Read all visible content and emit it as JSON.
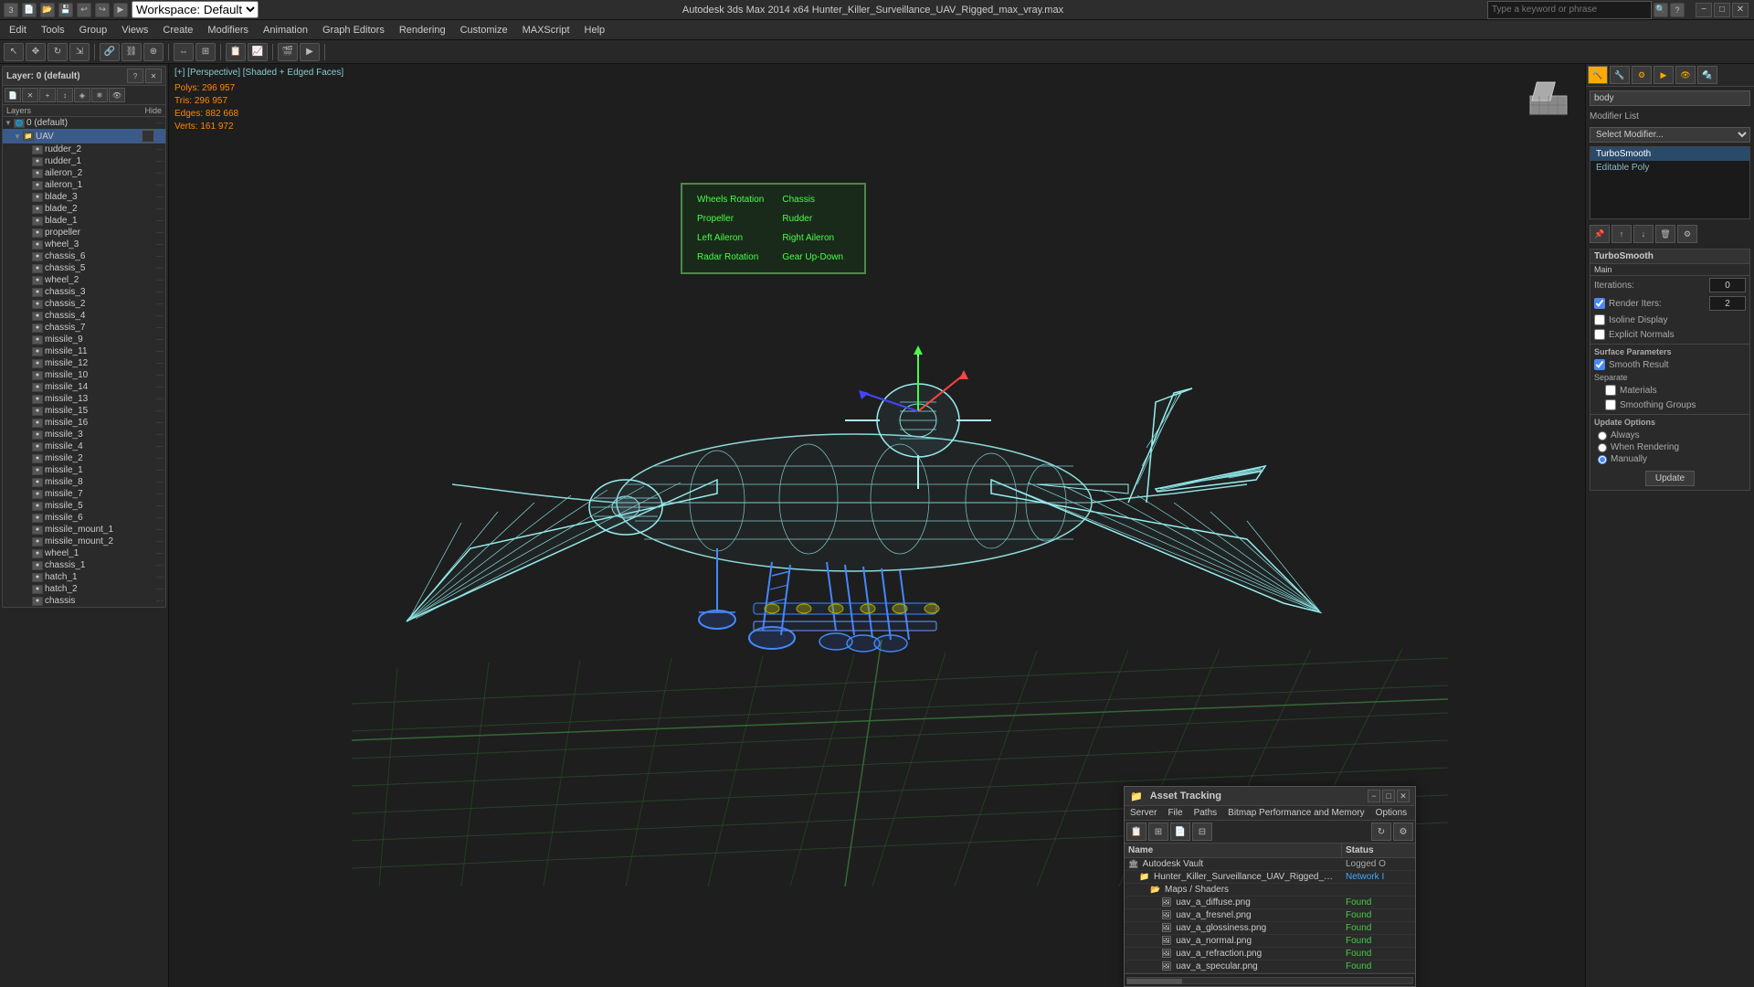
{
  "titlebar": {
    "title": "Autodesk 3ds Max 2014 x64    Hunter_Killer_Surveillance_UAV_Rigged_max_vray.max",
    "workspace": "Workspace: Default",
    "search_placeholder": "Type a keyword or phrase",
    "min_label": "−",
    "max_label": "□",
    "close_label": "✕"
  },
  "menubar": {
    "items": [
      "Edit",
      "Tools",
      "Group",
      "Views",
      "Create",
      "Modifiers",
      "Animation",
      "Graph Editors",
      "Rendering",
      "Customize",
      "MAXScript",
      "Help"
    ]
  },
  "toolbar": {
    "workspace_label": "Workspace: Default"
  },
  "viewport": {
    "label": "[+] [Perspective] [Shaded + Edged Faces]",
    "stats": {
      "polys_label": "Polys:",
      "polys_value": "296 957",
      "tris_label": "Tris:",
      "tris_value": "296 957",
      "edges_label": "Edges:",
      "edges_value": "882 668",
      "verts_label": "Verts:",
      "verts_value": "161 972"
    }
  },
  "layers": {
    "title": "Layer: 0 (default)",
    "col_name": "Layers",
    "col_hide": "Hide",
    "items": [
      {
        "id": "0default",
        "indent": 0,
        "name": "0 (default)",
        "expanded": true,
        "level": 0
      },
      {
        "id": "uav",
        "indent": 1,
        "name": "UAV",
        "expanded": true,
        "level": 1,
        "selected": true
      },
      {
        "id": "rudder_2",
        "indent": 2,
        "name": "rudder_2",
        "level": 2
      },
      {
        "id": "rudder_1",
        "indent": 2,
        "name": "rudder_1",
        "level": 2
      },
      {
        "id": "aileron_2",
        "indent": 2,
        "name": "aileron_2",
        "level": 2
      },
      {
        "id": "aileron_1",
        "indent": 2,
        "name": "aileron_1",
        "level": 2
      },
      {
        "id": "blade_3",
        "indent": 2,
        "name": "blade_3",
        "level": 2
      },
      {
        "id": "blade_2",
        "indent": 2,
        "name": "blade_2",
        "level": 2
      },
      {
        "id": "blade_1",
        "indent": 2,
        "name": "blade_1",
        "level": 2
      },
      {
        "id": "propeller",
        "indent": 2,
        "name": "propeller",
        "level": 2
      },
      {
        "id": "wheel_3",
        "indent": 2,
        "name": "wheel_3",
        "level": 2
      },
      {
        "id": "chassis_6",
        "indent": 2,
        "name": "chassis_6",
        "level": 2
      },
      {
        "id": "chassis_5",
        "indent": 2,
        "name": "chassis_5",
        "level": 2
      },
      {
        "id": "wheel_2",
        "indent": 2,
        "name": "wheel_2",
        "level": 2
      },
      {
        "id": "chassis_3",
        "indent": 2,
        "name": "chassis_3",
        "level": 2
      },
      {
        "id": "chassis_2",
        "indent": 2,
        "name": "chassis_2",
        "level": 2
      },
      {
        "id": "chassis_4",
        "indent": 2,
        "name": "chassis_4",
        "level": 2
      },
      {
        "id": "chassis_7",
        "indent": 2,
        "name": "chassis_7",
        "level": 2
      },
      {
        "id": "missile_9",
        "indent": 2,
        "name": "missile_9",
        "level": 2
      },
      {
        "id": "missile_11",
        "indent": 2,
        "name": "missile_11",
        "level": 2
      },
      {
        "id": "missile_12",
        "indent": 2,
        "name": "missile_12",
        "level": 2
      },
      {
        "id": "missile_10",
        "indent": 2,
        "name": "missile_10",
        "level": 2
      },
      {
        "id": "missile_14",
        "indent": 2,
        "name": "missile_14",
        "level": 2
      },
      {
        "id": "missile_13",
        "indent": 2,
        "name": "missile_13",
        "level": 2
      },
      {
        "id": "missile_15",
        "indent": 2,
        "name": "missile_15",
        "level": 2
      },
      {
        "id": "missile_16",
        "indent": 2,
        "name": "missile_16",
        "level": 2
      },
      {
        "id": "missile_3",
        "indent": 2,
        "name": "missile_3",
        "level": 2
      },
      {
        "id": "missile_4",
        "indent": 2,
        "name": "missile_4",
        "level": 2
      },
      {
        "id": "missile_2",
        "indent": 2,
        "name": "missile_2",
        "level": 2
      },
      {
        "id": "missile_1",
        "indent": 2,
        "name": "missile_1",
        "level": 2
      },
      {
        "id": "missile_8",
        "indent": 2,
        "name": "missile_8",
        "level": 2
      },
      {
        "id": "missile_7",
        "indent": 2,
        "name": "missile_7",
        "level": 2
      },
      {
        "id": "missile_5",
        "indent": 2,
        "name": "missile_5",
        "level": 2
      },
      {
        "id": "missile_6",
        "indent": 2,
        "name": "missile_6",
        "level": 2
      },
      {
        "id": "missile_mount_1",
        "indent": 2,
        "name": "missile_mount_1",
        "level": 2
      },
      {
        "id": "missile_mount_2",
        "indent": 2,
        "name": "missile_mount_2",
        "level": 2
      },
      {
        "id": "wheel_1",
        "indent": 2,
        "name": "wheel_1",
        "level": 2
      },
      {
        "id": "chassis_1",
        "indent": 2,
        "name": "chassis_1",
        "level": 2
      },
      {
        "id": "hatch_1",
        "indent": 2,
        "name": "hatch_1",
        "level": 2
      },
      {
        "id": "hatch_2",
        "indent": 2,
        "name": "hatch_2",
        "level": 2
      },
      {
        "id": "chassis_last",
        "indent": 2,
        "name": "chassis",
        "level": 2
      }
    ]
  },
  "modifier_panel": {
    "object_name": "body",
    "modifier_list_label": "Modifier List",
    "stack_items": [
      {
        "name": "TurboSmooth",
        "active": true
      },
      {
        "name": "Editable Poly",
        "active": false
      }
    ],
    "turbosmooth": {
      "section_label": "TurboSmooth",
      "main_label": "Main",
      "iterations_label": "Iterations:",
      "iterations_value": "0",
      "render_iters_label": "Render Iters:",
      "render_iters_value": "2",
      "isoline_label": "Isoline Display",
      "explicit_normals_label": "Explicit Normals",
      "surface_label": "Surface Parameters",
      "smooth_result_label": "Smooth Result",
      "separate_label": "Separate",
      "materials_label": "Materials",
      "smoothing_groups_label": "Smoothing Groups",
      "update_label": "Update Options",
      "always_label": "Always",
      "when_rendering_label": "When Rendering",
      "manually_label": "Manually",
      "update_btn": "Update"
    }
  },
  "asset_tracking": {
    "title": "Asset Tracking",
    "title_icon": "📁",
    "menus": [
      "Server",
      "File",
      "Paths",
      "Bitmap Performance and Memory",
      "Options"
    ],
    "table": {
      "col_name": "Name",
      "col_status": "Status"
    },
    "rows": [
      {
        "indent": 0,
        "icon": "vault",
        "name": "Autodesk Vault",
        "status": "Logged O",
        "status_class": "status-logged"
      },
      {
        "indent": 1,
        "icon": "file",
        "name": "Hunter_Killer_Surveillance_UAV_Rigged_max_vray.max",
        "status": "Network I",
        "status_class": "status-network"
      },
      {
        "indent": 2,
        "icon": "folder",
        "name": "Maps / Shaders",
        "status": "",
        "status_class": ""
      },
      {
        "indent": 3,
        "icon": "map",
        "name": "uav_a_diffuse.png",
        "status": "Found",
        "status_class": "status-found"
      },
      {
        "indent": 3,
        "icon": "map",
        "name": "uav_a_fresnel.png",
        "status": "Found",
        "status_class": "status-found"
      },
      {
        "indent": 3,
        "icon": "map",
        "name": "uav_a_glossiness.png",
        "status": "Found",
        "status_class": "status-found"
      },
      {
        "indent": 3,
        "icon": "map",
        "name": "uav_a_normal.png",
        "status": "Found",
        "status_class": "status-found"
      },
      {
        "indent": 3,
        "icon": "map",
        "name": "uav_a_refraction.png",
        "status": "Found",
        "status_class": "status-found"
      },
      {
        "indent": 3,
        "icon": "map",
        "name": "uav_a_specular.png",
        "status": "Found",
        "status_class": "status-found"
      }
    ]
  },
  "control_popup": {
    "buttons": [
      {
        "label": "Wheels Rotation",
        "col": 0,
        "row": 0
      },
      {
        "label": "Chassis",
        "col": 1,
        "row": 0
      },
      {
        "label": "Propeller",
        "col": 0,
        "row": 1
      },
      {
        "label": "Rudder",
        "col": 1,
        "row": 1
      },
      {
        "label": "Left Aileron",
        "col": 0,
        "row": 2
      },
      {
        "label": "Right Aileron",
        "col": 1,
        "row": 2
      },
      {
        "label": "Radar Rotation",
        "col": 0,
        "row": 3
      },
      {
        "label": "Gear Up-Down",
        "col": 1,
        "row": 3
      }
    ]
  }
}
